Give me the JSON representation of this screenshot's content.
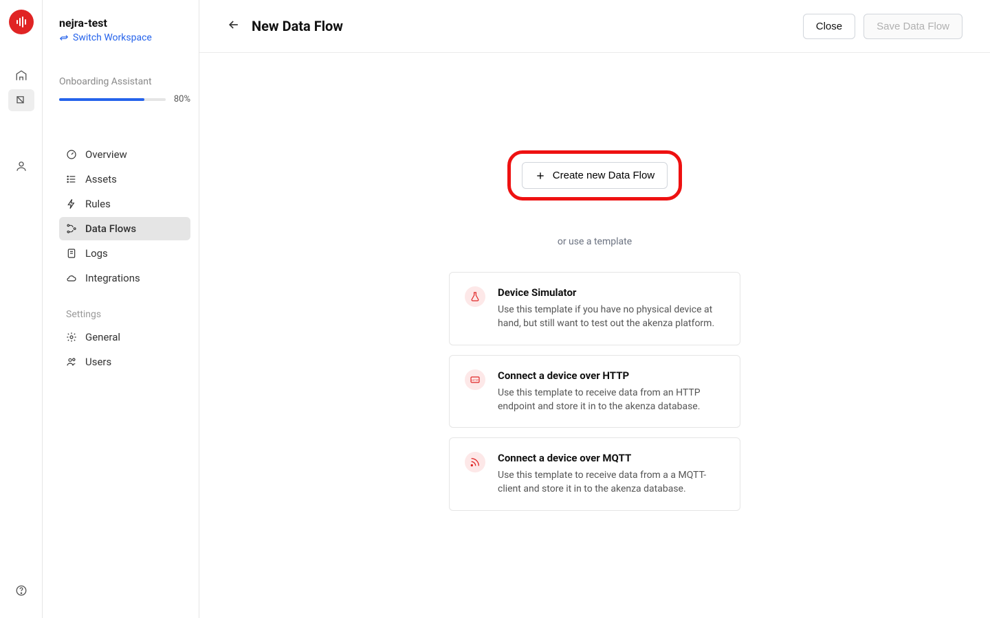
{
  "workspace": {
    "name": "nejra-test",
    "switch_label": "Switch Workspace"
  },
  "onboarding": {
    "label": "Onboarding Assistant",
    "percent_label": "80%",
    "percent_value": 80
  },
  "nav": {
    "overview": "Overview",
    "assets": "Assets",
    "rules": "Rules",
    "data_flows": "Data Flows",
    "logs": "Logs",
    "integrations": "Integrations",
    "settings_label": "Settings",
    "general": "General",
    "users": "Users"
  },
  "header": {
    "title": "New Data Flow",
    "close": "Close",
    "save": "Save Data Flow"
  },
  "main": {
    "create_label": "Create new Data Flow",
    "or_template": "or use a template",
    "templates": [
      {
        "title": "Device Simulator",
        "desc": "Use this template if you have no physical device at hand, but still want to test out the akenza platform."
      },
      {
        "title": "Connect a device over HTTP",
        "desc": "Use this template to receive data from an HTTP endpoint and store it in to the akenza database."
      },
      {
        "title": "Connect a device over MQTT",
        "desc": "Use this template to receive data from a a MQTT-client and store it in to the akenza database."
      }
    ]
  }
}
